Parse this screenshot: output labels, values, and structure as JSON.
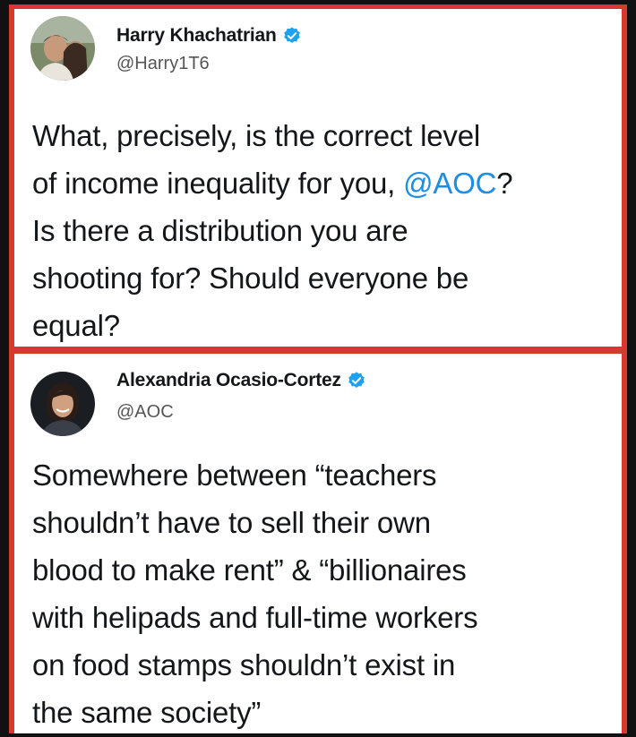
{
  "tweets": [
    {
      "author_name": "Harry Khachatrian",
      "handle": "@Harry1T6",
      "text_before": "What, precisely, is the correct level\nof income inequality for you, ",
      "mention": "@AOC",
      "text_after": "?\nIs there a distribution you are\nshooting for? Should everyone be\nequal?",
      "verified_icon": "verified-badge-icon",
      "avatar_icon": "profile-photo"
    },
    {
      "author_name": "Alexandria Ocasio-Cortez",
      "handle": "@AOC",
      "text": "Somewhere between “teachers\nshouldn’t have to sell their own\nblood to make rent” & “billionaires\nwith helipads and full-time workers\non food stamps shouldn’t exist in\nthe same society”",
      "verified_icon": "verified-badge-icon",
      "avatar_icon": "profile-photo"
    }
  ],
  "colors": {
    "frame": "#d63a2f",
    "mention": "#1b8ee6",
    "verified": "#1da1f2"
  }
}
